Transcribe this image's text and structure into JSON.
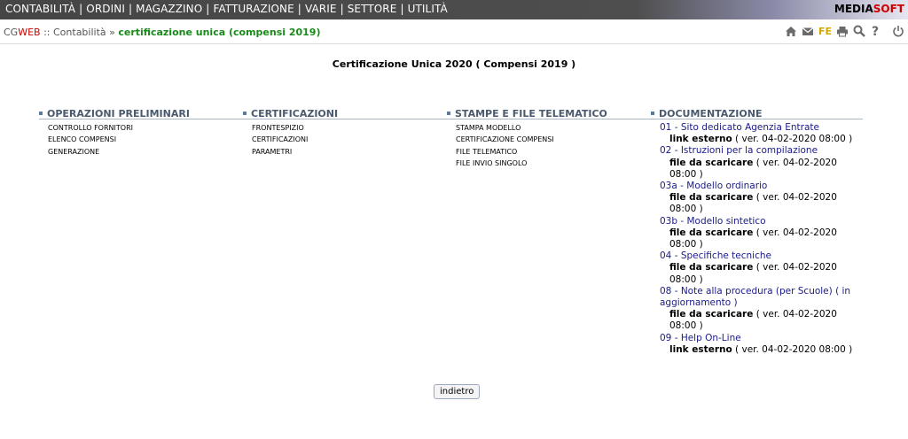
{
  "menu": {
    "items": [
      "CONTABILITÀ",
      "ORDINI",
      "MAGAZZINO",
      "FATTURAZIONE",
      "VARIE",
      "SETTORE",
      "UTILITÀ"
    ],
    "separator": "|"
  },
  "brand": {
    "media": "MEDIA",
    "soft": "SOFT"
  },
  "breadcrumb": {
    "cg": "CG",
    "web": "WEB",
    "sep1": " :: ",
    "section": "Contabilità",
    "sep2": " » ",
    "current": "certificazione unica (compensi 2019)"
  },
  "toolbar": {
    "fe_label": "FE"
  },
  "page": {
    "title": "Certificazione Unica 2020 ( Compensi 2019 )"
  },
  "columns": {
    "preliminari": {
      "title": "OPERAZIONI PRELIMINARI",
      "items": [
        "CONTROLLO FORNITORI",
        "ELENCO COMPENSI",
        "GENERAZIONE"
      ]
    },
    "certificazioni": {
      "title": "CERTIFICAZIONI",
      "items": [
        "FRONTESPIZIO",
        "CERTIFICAZIONI",
        "PARAMETRI"
      ]
    },
    "stampe": {
      "title": "STAMPE E FILE TELEMATICO",
      "items": [
        "STAMPA MODELLO",
        "CERTIFICAZIONE COMPENSI",
        "FILE TELEMATICO",
        "FILE INVIO SINGOLO"
      ]
    },
    "documentazione": {
      "title": "DOCUMENTAZIONE",
      "items": [
        {
          "label": "01 - Sito dedicato Agenzia Entrate",
          "type": "link esterno",
          "version": " ( ver. 04-02-2020 08:00 )"
        },
        {
          "label": "02 - Istruzioni per la compilazione",
          "type": "file da scaricare",
          "version": " ( ver. 04-02-2020 08:00 )"
        },
        {
          "label": "03a - Modello ordinario",
          "type": "file da scaricare",
          "version": " ( ver. 04-02-2020 08:00 )"
        },
        {
          "label": "03b - Modello sintetico",
          "type": "file da scaricare",
          "version": " ( ver. 04-02-2020 08:00 )"
        },
        {
          "label": "04 - Specifiche tecniche",
          "type": "file da scaricare",
          "version": " ( ver. 04-02-2020 08:00 )"
        },
        {
          "label": "08 - Note alla procedura (per Scuole) ( in aggiornamento )",
          "type": "file da scaricare",
          "version": " ( ver. 04-02-2020 08:00 )"
        },
        {
          "label": "09 - Help On-Line",
          "type": "link esterno",
          "version": " ( ver. 04-02-2020 08:00 )"
        }
      ]
    }
  },
  "back_button": {
    "label": "indietro"
  }
}
